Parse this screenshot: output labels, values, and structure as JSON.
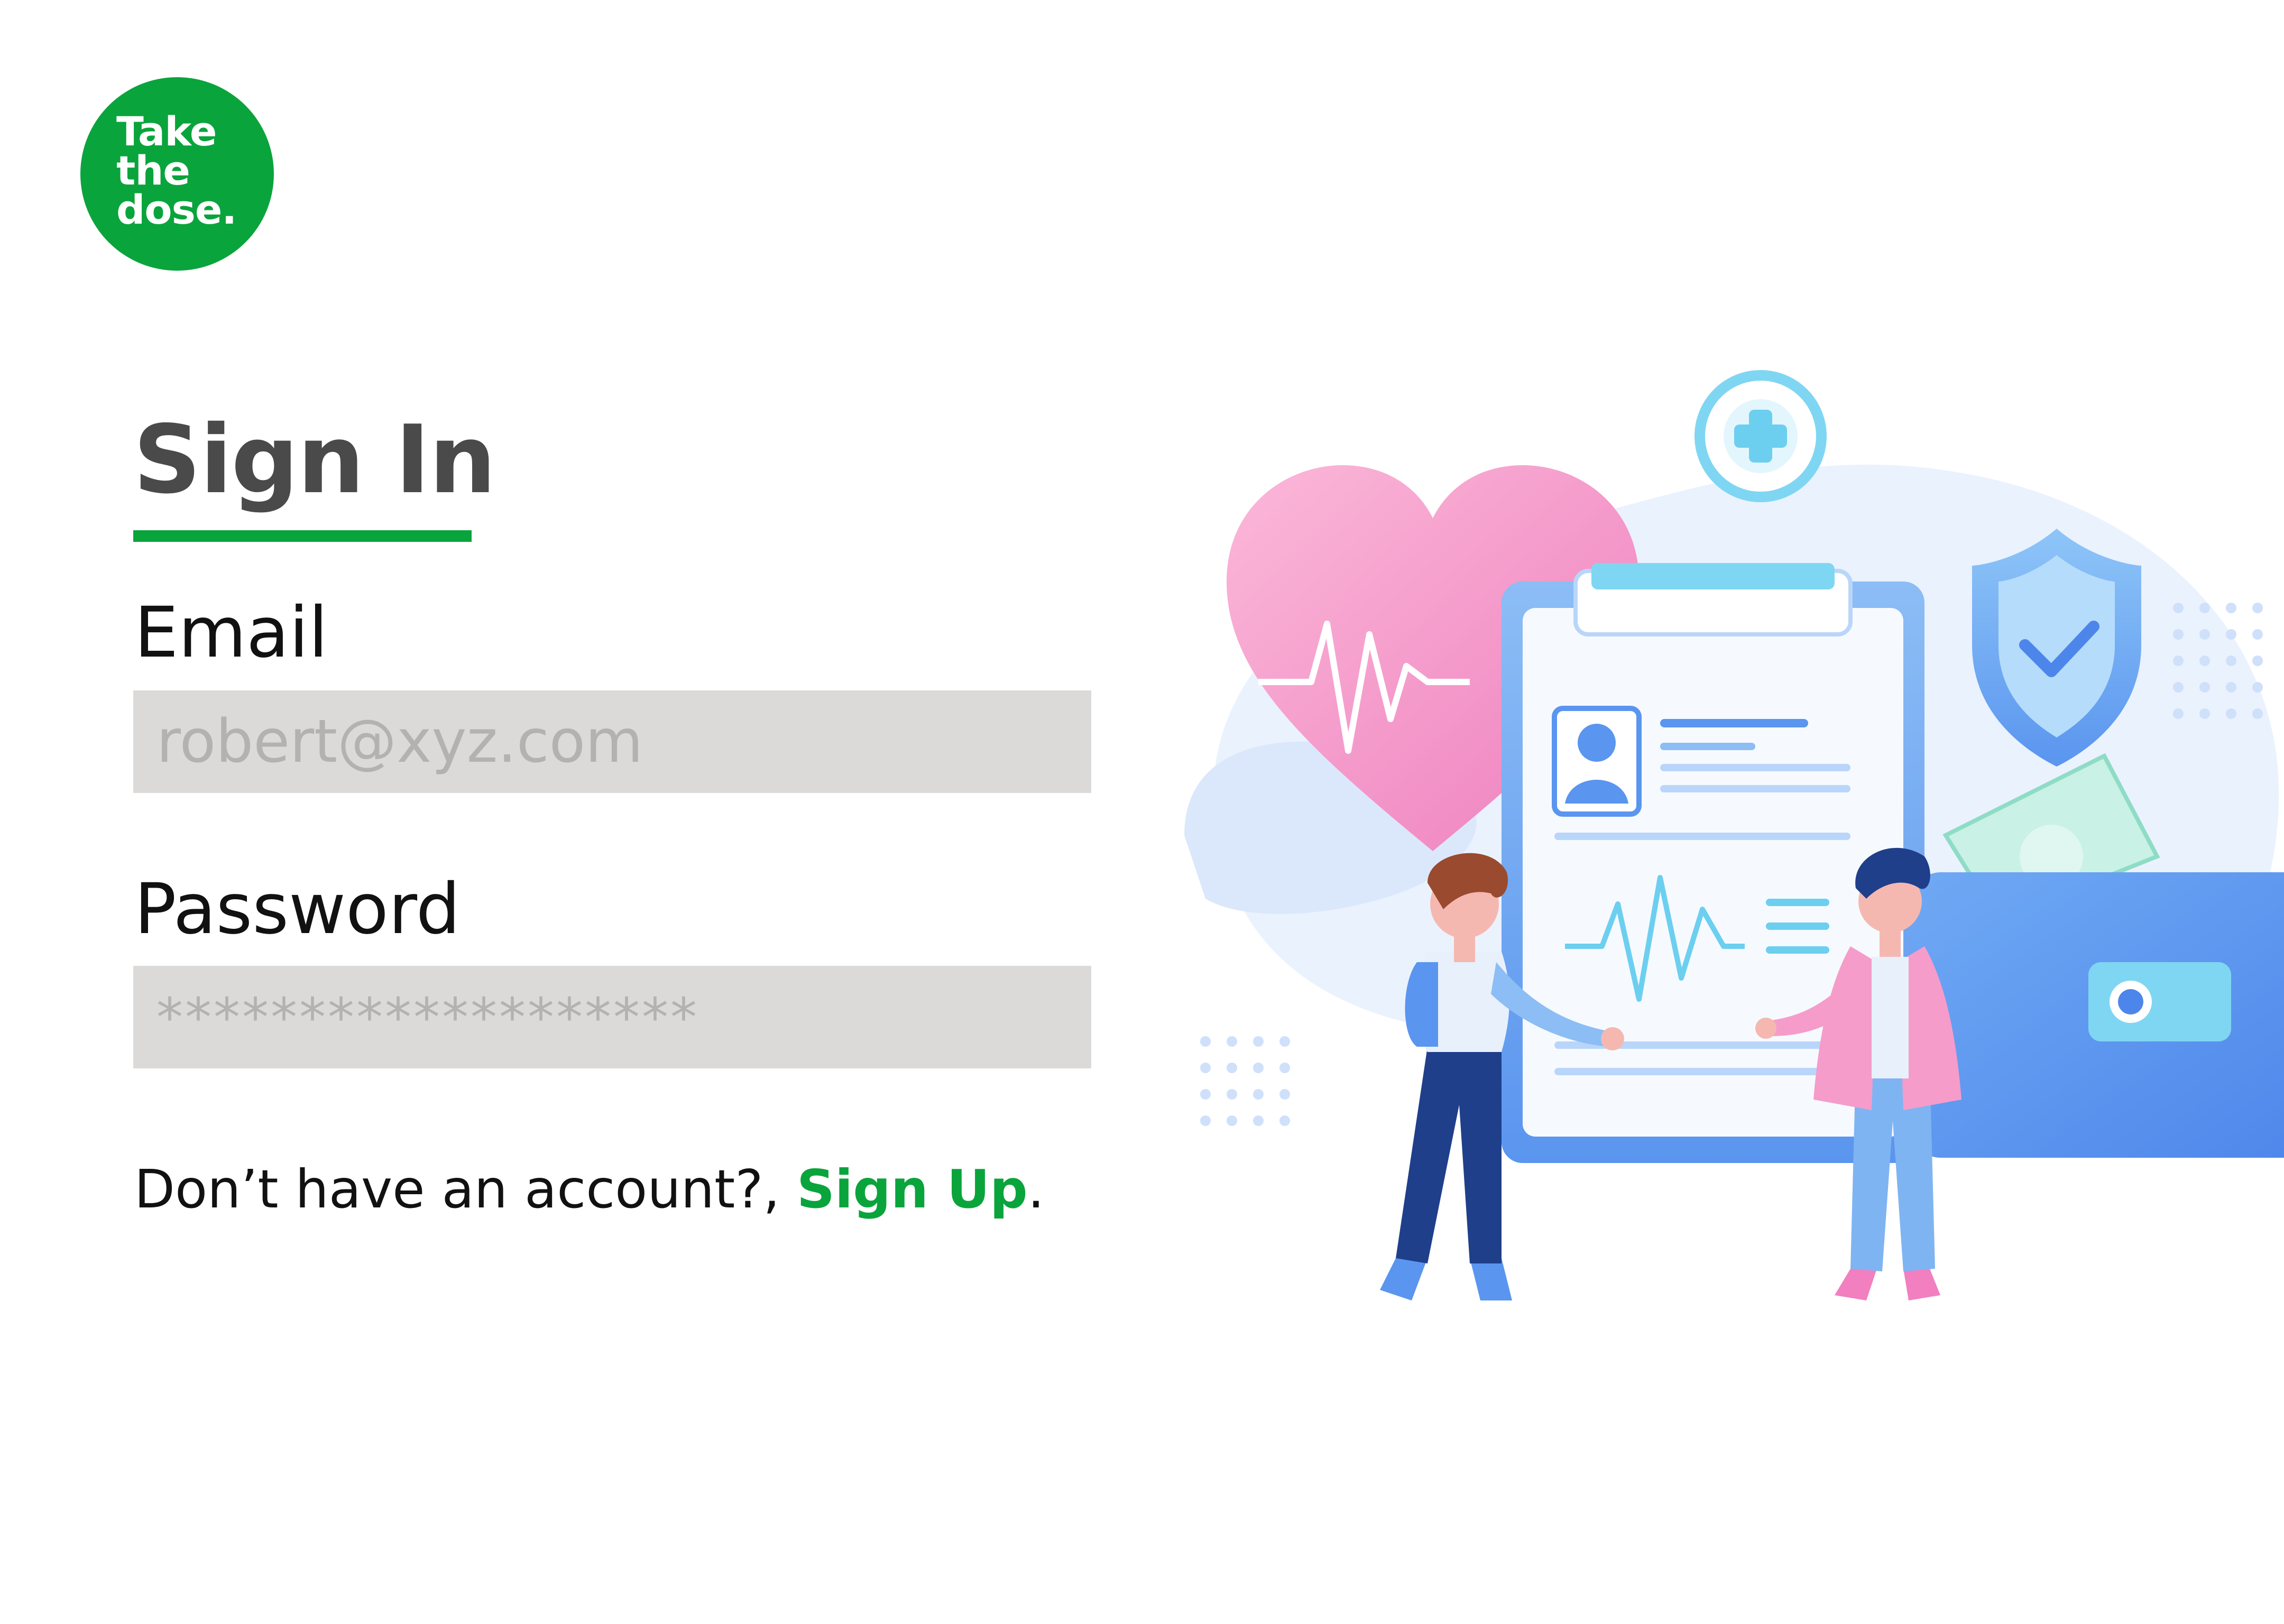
{
  "logo": {
    "line1": "Take",
    "line2": "the",
    "line3": "dose."
  },
  "form": {
    "title": "Sign In",
    "email_label": "Email",
    "email_placeholder": "robert@xyz.com",
    "password_label": "Password",
    "password_placeholder": "*******************"
  },
  "footer": {
    "prompt": "Don’t have an account?, ",
    "signup_link": "Sign Up",
    "trailing": "."
  },
  "colors": {
    "brand_green": "#0aa43c",
    "field_bg": "#dbdad8",
    "title_text": "#4a4a4a"
  }
}
